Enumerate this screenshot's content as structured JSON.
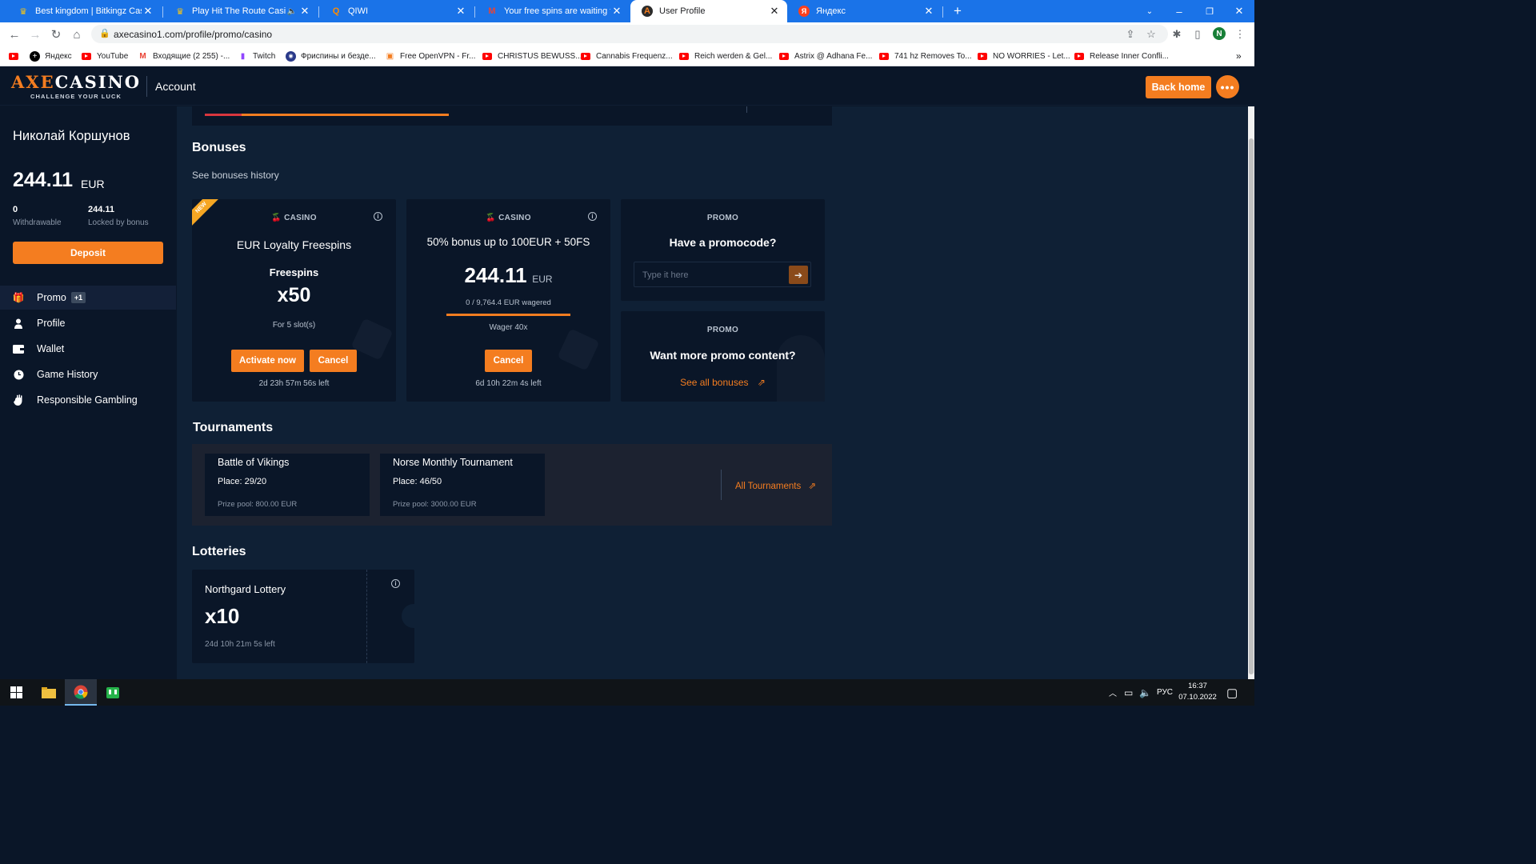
{
  "browser": {
    "tabs": [
      {
        "title": "Best kingdom | Bitkingz Casino",
        "fav": "♛",
        "fav_color": "#f5c518"
      },
      {
        "title": "Play Hit The Route Casino Ga",
        "fav": "♛",
        "fav_color": "#f5c518"
      },
      {
        "title": "QIWI",
        "fav": "Q",
        "fav_color": "#ff8c00"
      },
      {
        "title": "Your free spins are waiting for yo",
        "fav": "M",
        "fav_color": "#ea4335"
      },
      {
        "title": "User Profile",
        "fav": "A",
        "fav_color": "#f47d20"
      },
      {
        "title": "Яндекс",
        "fav": "Я",
        "fav_color": "#fc3f1d"
      }
    ],
    "new_tab": "+",
    "url": "axecasino1.com/profile/promo/casino",
    "profile_initial": "N",
    "bookmarks": [
      {
        "label": "",
        "type": "yt"
      },
      {
        "label": "Яндекс",
        "type": "icon",
        "icon": "⊕"
      },
      {
        "label": "YouTube",
        "type": "yt"
      },
      {
        "label": "Входящие (2 255) -...",
        "type": "icon",
        "icon": "M"
      },
      {
        "label": "Twitch",
        "type": "icon",
        "icon": "▮"
      },
      {
        "label": "Фриспины и безде...",
        "type": "icon",
        "icon": "◉"
      },
      {
        "label": "Free OpenVPN - Fr...",
        "type": "icon",
        "icon": "▣"
      },
      {
        "label": "CHRISTUS BEWUSS...",
        "type": "yt"
      },
      {
        "label": "Cannabis Frequenz...",
        "type": "yt"
      },
      {
        "label": "Reich werden & Gel...",
        "type": "yt"
      },
      {
        "label": "Astrix @ Adhana Fe...",
        "type": "yt"
      },
      {
        "label": "741 hz Removes To...",
        "type": "yt"
      },
      {
        "label": "NO WORRIES - Let...",
        "type": "yt"
      },
      {
        "label": "Release Inner Confli...",
        "type": "yt"
      }
    ],
    "more_bookmarks": "»"
  },
  "header": {
    "logo_axe": "AXE",
    "logo_rest": "CASINO",
    "logo_tagline": "CHALLENGE YOUR LUCK",
    "title": "Account",
    "back_home": "Back home",
    "more": "•••"
  },
  "sidebar": {
    "user_name": "Николай Коршунов",
    "balance": "244.11",
    "currency": "EUR",
    "withdrawable_value": "0",
    "withdrawable_label": "Withdrawable",
    "locked_value": "244.11",
    "locked_label": "Locked by bonus",
    "deposit": "Deposit",
    "menu": [
      {
        "label": "Promo",
        "icon": "gift-icon",
        "badge": "+1"
      },
      {
        "label": "Profile",
        "icon": "user-icon"
      },
      {
        "label": "Wallet",
        "icon": "wallet-icon"
      },
      {
        "label": "Game History",
        "icon": "history-icon"
      },
      {
        "label": "Responsible Gambling",
        "icon": "hand-icon"
      }
    ]
  },
  "bonuses": {
    "title": "Bonuses",
    "history_link": "See bonuses history",
    "card1": {
      "ribbon": "NEW",
      "category": "CASINO",
      "name": "EUR Loyalty Freespins",
      "type": "Freespins",
      "amount": "x50",
      "slots": "For 5 slot(s)",
      "activate": "Activate now",
      "cancel": "Cancel",
      "time_left": "2d 23h 57m 56s left"
    },
    "card2": {
      "category": "CASINO",
      "name": "50% bonus up to 100EUR + 50FS",
      "amount": "244.11",
      "currency": "EUR",
      "wagered": "0 / 9,764.4 EUR wagered",
      "wager_progress": 0,
      "wager": "Wager 40x",
      "cancel": "Cancel",
      "time_left": "6d 10h 22m 4s left"
    },
    "promo1": {
      "category": "PROMO",
      "title": "Have a promocode?",
      "placeholder": "Type it here"
    },
    "promo2": {
      "category": "PROMO",
      "title": "Want more promo content?",
      "link": "See all bonuses"
    }
  },
  "tournaments": {
    "title": "Tournaments",
    "items": [
      {
        "name": "Battle of Vikings",
        "place": "Place: 29/20",
        "prize": "Prize pool: 800.00 EUR"
      },
      {
        "name": "Norse Monthly Tournament",
        "place": "Place: 46/50",
        "prize": "Prize pool: 3000.00 EUR"
      }
    ],
    "all_link": "All Tournaments"
  },
  "lotteries": {
    "title": "Lotteries",
    "name": "Northgard Lottery",
    "multiplier": "x10",
    "time_left": "24d 10h 21m 5s left"
  },
  "taskbar": {
    "lang": "РУС",
    "time": "16:37",
    "date": "07.10.2022"
  },
  "colors": {
    "accent": "#f47d20",
    "background": "#0f2035",
    "card": "#0a1628"
  }
}
